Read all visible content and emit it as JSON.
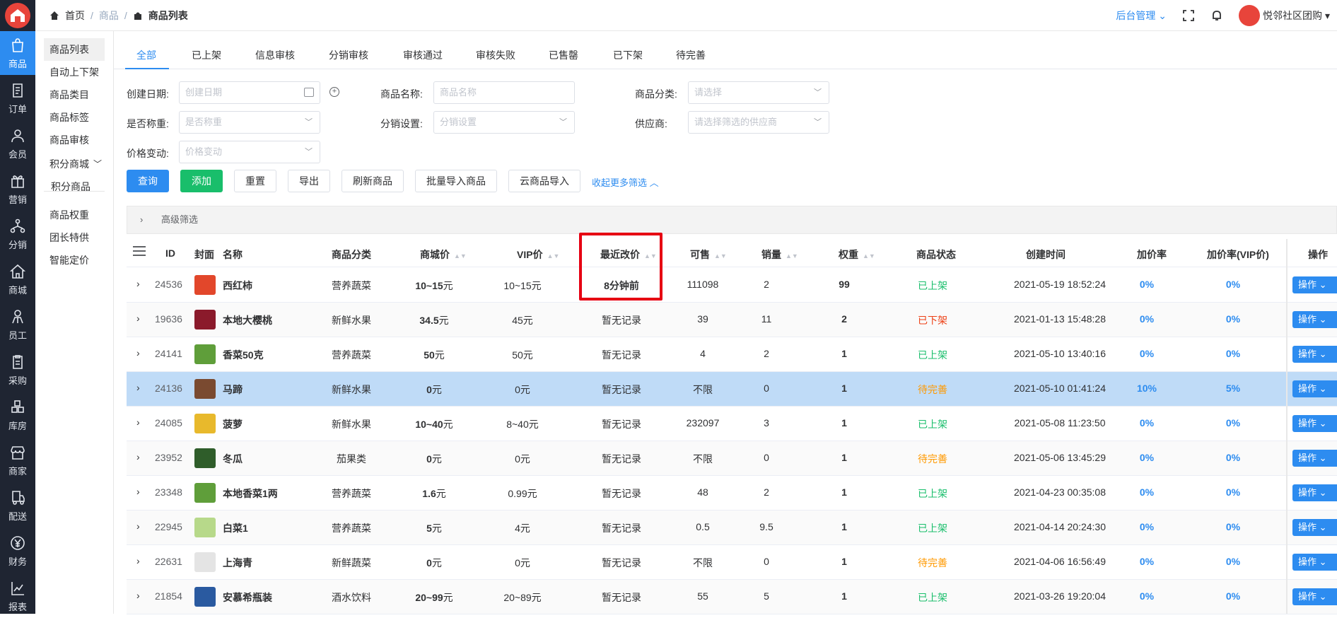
{
  "rail": {
    "items": [
      {
        "label": "商品",
        "icon": "bag-icon",
        "active": true
      },
      {
        "label": "订单",
        "icon": "document-icon"
      },
      {
        "label": "会员",
        "icon": "user-icon"
      },
      {
        "label": "营销",
        "icon": "gift-icon"
      },
      {
        "label": "分销",
        "icon": "network-icon"
      },
      {
        "label": "商城",
        "icon": "home-icon"
      },
      {
        "label": "员工",
        "icon": "staff-icon"
      },
      {
        "label": "采购",
        "icon": "clipboard-icon"
      },
      {
        "label": "库房",
        "icon": "warehouse-icon"
      },
      {
        "label": "商家",
        "icon": "shop-icon"
      },
      {
        "label": "配送",
        "icon": "delivery-icon"
      },
      {
        "label": "财务",
        "icon": "yen-icon"
      },
      {
        "label": "报表",
        "icon": "report-icon"
      }
    ]
  },
  "submenu": {
    "items": [
      "商品列表",
      "自动上下架",
      "商品类目",
      "商品标签",
      "商品审核",
      "积分商城",
      "积分商品",
      "商品权重",
      "团长特供",
      "智能定价"
    ]
  },
  "topbar": {
    "home": "首页",
    "crumb_mid": "商品",
    "crumb_current": "商品列表",
    "admin": "后台管理",
    "user": "悦邻社区团购"
  },
  "tabs": [
    "全部",
    "已上架",
    "信息审核",
    "分销审核",
    "审核通过",
    "审核失败",
    "已售罄",
    "已下架",
    "待完善"
  ],
  "filters": {
    "create_date_label": "创建日期:",
    "create_date_ph": "创建日期",
    "name_label": "商品名称:",
    "name_ph": "商品名称",
    "category_label": "商品分类:",
    "category_ph": "请选择",
    "weigh_label": "是否称重:",
    "weigh_ph": "是否称重",
    "dist_label": "分销设置:",
    "dist_ph": "分销设置",
    "supplier_label": "供应商:",
    "supplier_ph": "请选择筛选的供应商",
    "price_change_label": "价格变动:",
    "price_change_ph": "价格变动"
  },
  "buttons": {
    "query": "查询",
    "add": "添加",
    "reset": "重置",
    "export": "导出",
    "refresh": "刷新商品",
    "batch_import": "批量导入商品",
    "cloud_import": "云商品导入",
    "collapse": "收起更多筛选"
  },
  "advanced": "高级筛选",
  "columns": {
    "id": "ID",
    "cover": "封面",
    "name": "名称",
    "category": "商品分类",
    "mall_price": "商城价",
    "vip_price": "VIP价",
    "last_change": "最近改价",
    "available": "可售",
    "sales": "销量",
    "weight": "权重",
    "status": "商品状态",
    "created": "创建时间",
    "markup": "加价率",
    "markup_vip": "加价率(VIP价)",
    "ops": "操作"
  },
  "op_label": "操作",
  "rows": [
    {
      "id": "24536",
      "name": "西红柿",
      "category": "营养蔬菜",
      "price": "10~15",
      "unit": "元",
      "vip": "10~15元",
      "last": "8分钟前",
      "avail": "111098",
      "sales": "2",
      "weight": "99",
      "status": "已上架",
      "st": "on",
      "created": "2021-05-19 18:52:24",
      "markup": "0%",
      "markup_vip": "0%",
      "thumb": "#e2472b"
    },
    {
      "id": "19636",
      "name": "本地大樱桃",
      "category": "新鲜水果",
      "price": "34.5",
      "unit": "元",
      "vip": "45元",
      "last": "暂无记录",
      "avail": "39",
      "sales": "11",
      "weight": "2",
      "status": "已下架",
      "st": "off",
      "created": "2021-01-13 15:48:28",
      "markup": "0%",
      "markup_vip": "0%",
      "thumb": "#8b1a2b"
    },
    {
      "id": "24141",
      "name": "香菜50克",
      "category": "营养蔬菜",
      "price": "50",
      "unit": "元",
      "vip": "50元",
      "last": "暂无记录",
      "avail": "4",
      "sales": "2",
      "weight": "1",
      "status": "已上架",
      "st": "on",
      "created": "2021-05-10 13:40:16",
      "markup": "0%",
      "markup_vip": "0%",
      "thumb": "#5f9e3a"
    },
    {
      "id": "24136",
      "name": "马蹄",
      "category": "新鲜水果",
      "price": "0",
      "unit": "元",
      "vip": "0元",
      "last": "暂无记录",
      "avail": "不限",
      "sales": "0",
      "weight": "1",
      "status": "待完善",
      "st": "pend",
      "created": "2021-05-10 01:41:24",
      "markup": "10%",
      "markup_vip": "5%",
      "thumb": "#7a4a30"
    },
    {
      "id": "24085",
      "name": "菠萝",
      "category": "新鲜水果",
      "price": "10~40",
      "unit": "元",
      "vip": "8~40元",
      "last": "暂无记录",
      "avail": "232097",
      "sales": "3",
      "weight": "1",
      "status": "已上架",
      "st": "on",
      "created": "2021-05-08 11:23:50",
      "markup": "0%",
      "markup_vip": "0%",
      "thumb": "#e8b92c"
    },
    {
      "id": "23952",
      "name": "冬瓜",
      "category": "茄果类",
      "price": "0",
      "unit": "元",
      "vip": "0元",
      "last": "暂无记录",
      "avail": "不限",
      "sales": "0",
      "weight": "1",
      "status": "待完善",
      "st": "pend",
      "created": "2021-05-06 13:45:29",
      "markup": "0%",
      "markup_vip": "0%",
      "thumb": "#2f5d2a"
    },
    {
      "id": "23348",
      "name": "本地香菜1两",
      "category": "营养蔬菜",
      "price": "1.6",
      "unit": "元",
      "vip": "0.99元",
      "last": "暂无记录",
      "avail": "48",
      "sales": "2",
      "weight": "1",
      "status": "已上架",
      "st": "on",
      "created": "2021-04-23 00:35:08",
      "markup": "0%",
      "markup_vip": "0%",
      "thumb": "#5f9e3a"
    },
    {
      "id": "22945",
      "name": "白菜1",
      "category": "营养蔬菜",
      "price": "5",
      "unit": "元",
      "vip": "4元",
      "last": "暂无记录",
      "avail": "0.5",
      "sales": "9.5",
      "weight": "1",
      "status": "已上架",
      "st": "on",
      "created": "2021-04-14 20:24:30",
      "markup": "0%",
      "markup_vip": "0%",
      "thumb": "#b7d98a"
    },
    {
      "id": "22631",
      "name": "上海青",
      "category": "新鲜蔬菜",
      "price": "0",
      "unit": "元",
      "vip": "0元",
      "last": "暂无记录",
      "avail": "不限",
      "sales": "0",
      "weight": "1",
      "status": "待完善",
      "st": "pend",
      "created": "2021-04-06 16:56:49",
      "markup": "0%",
      "markup_vip": "0%",
      "thumb": "#e4e4e4"
    },
    {
      "id": "21854",
      "name": "安慕希瓶装",
      "category": "酒水饮料",
      "price": "20~99",
      "unit": "元",
      "vip": "20~89元",
      "last": "暂无记录",
      "avail": "55",
      "sales": "5",
      "weight": "1",
      "status": "已上架",
      "st": "on",
      "created": "2021-03-26 19:20:04",
      "markup": "0%",
      "markup_vip": "0%",
      "thumb": "#2a5aa0"
    }
  ]
}
